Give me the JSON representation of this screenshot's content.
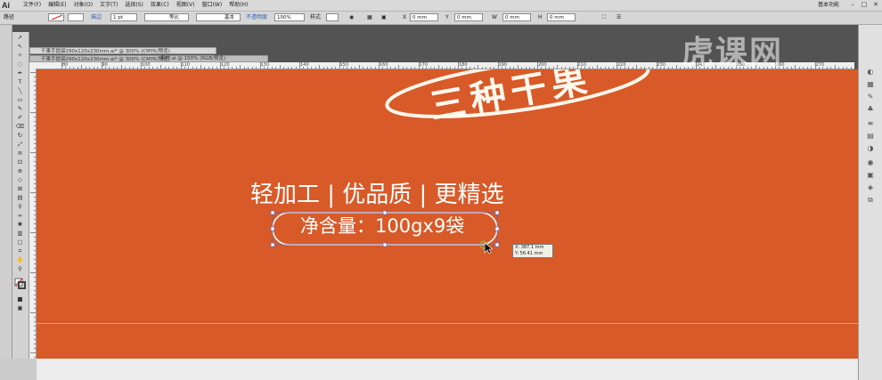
{
  "app": {
    "logo": "Ai",
    "workspace": "基本功能",
    "window_buttons": [
      "–",
      "□",
      "✕"
    ]
  },
  "menu": [
    "文件(F)",
    "编辑(E)",
    "对象(O)",
    "文字(T)",
    "选择(S)",
    "效果(C)",
    "视图(V)",
    "窗口(W)",
    "帮助(H)"
  ],
  "control_bar": {
    "group_label": "路径",
    "stroke_label": "描边",
    "stroke_value": "1 pt",
    "profile_label": "等比",
    "brush_label": "基本",
    "opacity_label": "不透明度",
    "opacity_value": "100%",
    "style_label": "样式",
    "x_value": "0 mm",
    "y_value": "0 mm",
    "w_value": "0 mm",
    "h_value": "0 mm"
  },
  "tabs": [
    {
      "label": "干果手提袋290x120x230mm.ai* @ 300% (CMYK/预览)"
    },
    {
      "label": "干果手提袋290x120x230mm.ai* @ 300% (CMYK/预览)"
    },
    {
      "label": "素材.ai @ 150% (RGB/预览)"
    }
  ],
  "ruler": {
    "ticks": [
      "80",
      "90",
      "100",
      "110",
      "120",
      "130",
      "140",
      "150",
      "160",
      "170",
      "180",
      "190",
      "200",
      "210",
      "220",
      "230",
      "240",
      "250",
      "260",
      "270",
      "280"
    ]
  },
  "artwork": {
    "brand": "三种干果",
    "slogan": "轻加工 | 优品质 | 更精选",
    "net_weight": "净含量：100gx9袋",
    "tooltip_x": "X: 387.1 mm",
    "tooltip_y": "Y: 56.41 mm"
  },
  "watermark": "虎课网",
  "colors": {
    "canvas": "#d85a28",
    "selection": "#4a64c8"
  }
}
